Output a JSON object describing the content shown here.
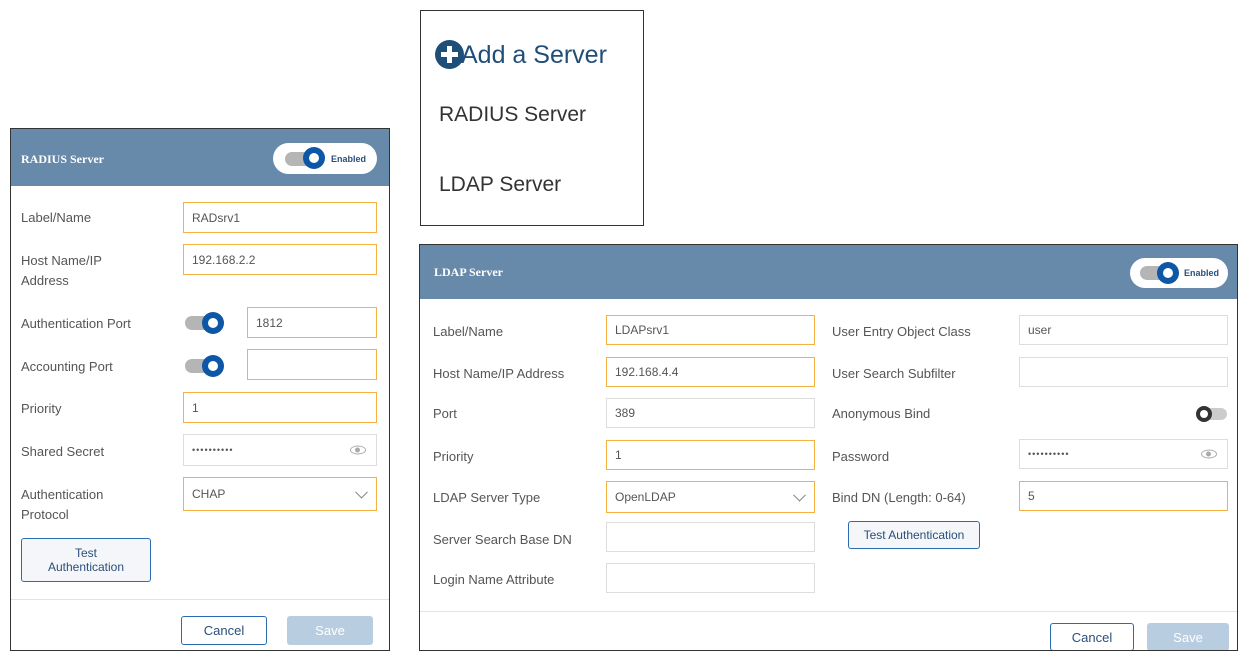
{
  "add_menu": {
    "title": "Add a Server",
    "items": [
      "RADIUS Server",
      "LDAP Server"
    ]
  },
  "radius": {
    "title": "RADIUS Server",
    "enabled_label": "Enabled",
    "enabled": true,
    "fields": {
      "label_name": {
        "label": "Label/Name",
        "value": "RADsrv1"
      },
      "host": {
        "label": "Host Name/IP Address",
        "value": "192.168.2.2"
      },
      "auth_port": {
        "label": "Authentication Port",
        "value": "1812",
        "enabled": true
      },
      "acct_port": {
        "label": "Accounting Port",
        "value": "",
        "enabled": true
      },
      "priority": {
        "label": "Priority",
        "value": "1"
      },
      "secret": {
        "label": "Shared Secret",
        "value": "••••••••••"
      },
      "protocol": {
        "label": "Authentication Protocol",
        "value": "CHAP"
      }
    },
    "test_button": "Test Authentication",
    "cancel_button": "Cancel",
    "save_button": "Save"
  },
  "ldap": {
    "title": "LDAP Server",
    "enabled_label": "Enabled",
    "enabled": true,
    "left_fields": {
      "label_name": {
        "label": "Label/Name",
        "value": "LDAPsrv1"
      },
      "host": {
        "label": "Host Name/IP Address",
        "value": "192.168.4.4"
      },
      "port": {
        "label": "Port",
        "value": "389"
      },
      "priority": {
        "label": "Priority",
        "value": "1"
      },
      "server_type": {
        "label": "LDAP Server Type",
        "value": "OpenLDAP"
      },
      "base_dn": {
        "label": "Server Search Base DN",
        "value": ""
      },
      "login_attr": {
        "label": "Login Name Attribute",
        "value": ""
      }
    },
    "right_fields": {
      "object_class": {
        "label": "User Entry Object Class",
        "value": "user"
      },
      "subfilter": {
        "label": "User Search Subfilter",
        "value": ""
      },
      "anon_bind": {
        "label": "Anonymous Bind",
        "enabled": false
      },
      "password": {
        "label": "Password",
        "value": "••••••••••"
      },
      "bind_dn": {
        "label": "Bind DN (Length: 0-64)",
        "value": "5"
      }
    },
    "test_button": "Test Authentication",
    "cancel_button": "Cancel",
    "save_button": "Save"
  },
  "colors": {
    "header": "#6789aa",
    "accent": "#0e56a6",
    "active_border": "#f5b142",
    "title_blue": "#1f4e79"
  }
}
